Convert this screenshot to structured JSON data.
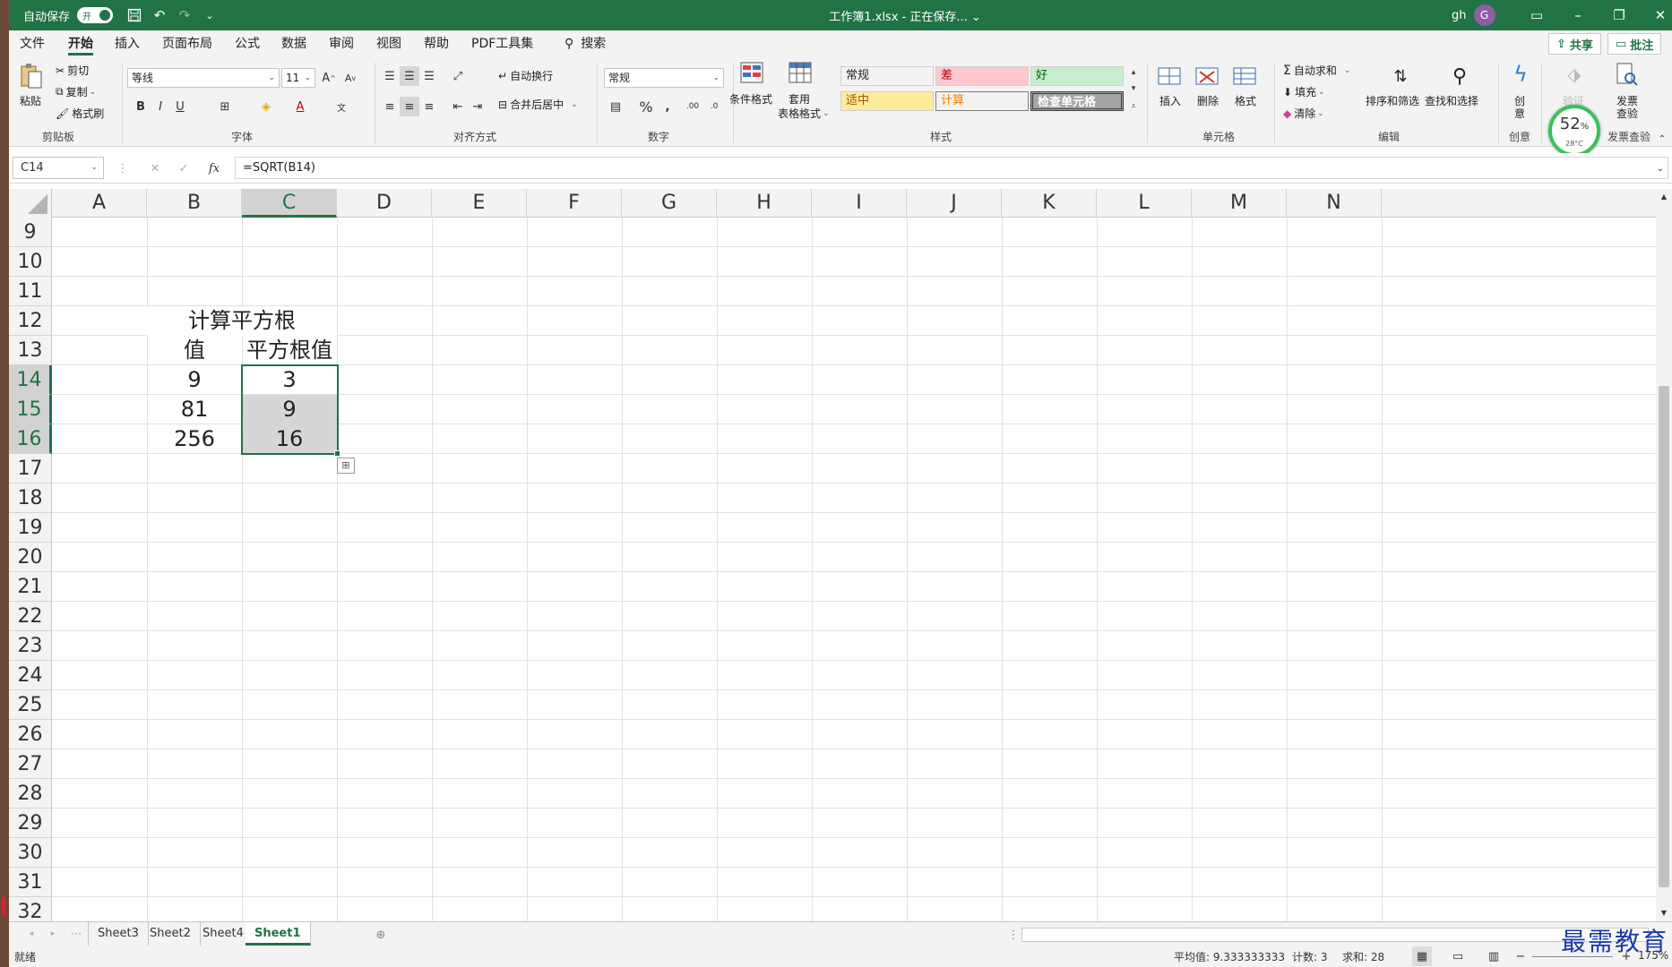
{
  "titlebar": {
    "autosave_label": "自动保存",
    "autosave_state": "开",
    "doc_title": "工作簿1.xlsx - 正在保存... ⌄",
    "user_name": "gh",
    "avatar_letter": "G"
  },
  "tabs": [
    "文件",
    "开始",
    "插入",
    "页面布局",
    "公式",
    "数据",
    "审阅",
    "视图",
    "帮助",
    "PDF工具集"
  ],
  "active_tab": "开始",
  "search_label": "搜索",
  "share_label": "共享",
  "comment_label": "批注",
  "ribbon": {
    "clipboard": {
      "paste": "粘贴",
      "cut": "剪切",
      "copy": "复制",
      "format_painter": "格式刷",
      "label": "剪贴板"
    },
    "font": {
      "name": "等线",
      "size": "11",
      "label": "字体"
    },
    "alignment": {
      "wrap": "自动换行",
      "merge": "合并后居中",
      "label": "对齐方式"
    },
    "number": {
      "format": "常规",
      "label": "数字"
    },
    "styles": {
      "conditional": "条件格式",
      "table_line1": "套用",
      "table_line2": "表格格式",
      "cells": [
        {
          "text": "常规",
          "bg": "#ffffff",
          "color": "#222222"
        },
        {
          "text": "差",
          "bg": "#ffc7ce",
          "color": "#9c0006"
        },
        {
          "text": "好",
          "bg": "#c6efce",
          "color": "#006100"
        },
        {
          "text": "适中",
          "bg": "#ffeb9c",
          "color": "#9c5700"
        },
        {
          "text": "计算",
          "bg": "#f2f2f2",
          "color": "#fa7d00"
        },
        {
          "text": "检查单元格",
          "bg": "#a5a5a5",
          "color": "#ffffff"
        }
      ],
      "label": "样式"
    },
    "cells_group": {
      "insert": "插入",
      "delete": "删除",
      "format": "格式",
      "label": "单元格"
    },
    "editing": {
      "autosum": "自动求和",
      "fill": "填充",
      "clear": "清除",
      "sort": "排序和筛选",
      "find": "查找和选择",
      "label": "编辑"
    },
    "creative": {
      "btn_line1": "创",
      "btn_line2": "意",
      "label": "创意"
    },
    "invoice": {
      "line1": "发票",
      "line2": "查验",
      "label": "发票查验"
    },
    "faded_btn": "验证"
  },
  "badge": {
    "percent": "52",
    "percent_sign": "%",
    "temp": "28°C"
  },
  "formula_bar": {
    "name_box": "C14",
    "formula": "=SQRT(B14)"
  },
  "columns": [
    "A",
    "B",
    "C",
    "D",
    "E",
    "F",
    "G",
    "H",
    "I",
    "J",
    "K",
    "L",
    "M",
    "N"
  ],
  "selected_column": "C",
  "rows": [
    "9",
    "10",
    "11",
    "12",
    "13",
    "14",
    "15",
    "16",
    "17",
    "18",
    "19",
    "20",
    "21",
    "22",
    "23",
    "24",
    "25",
    "26",
    "27",
    "28",
    "29",
    "30",
    "31",
    "32"
  ],
  "selected_rows": [
    "14",
    "15",
    "16"
  ],
  "sheet": {
    "title": "计算平方根",
    "header_value": "值",
    "header_sqrt": "平方根值",
    "data": [
      {
        "value": "9",
        "sqrt": "3"
      },
      {
        "value": "81",
        "sqrt": "9"
      },
      {
        "value": "256",
        "sqrt": "16"
      }
    ]
  },
  "sheet_tabs": [
    "Sheet3",
    "Sheet2",
    "Sheet4",
    "Sheet1"
  ],
  "active_sheet": "Sheet1",
  "status": {
    "ready": "就绪",
    "average": "平均值: 9.333333333",
    "count": "计数: 3",
    "sum": "求和: 28",
    "zoom": "175%"
  },
  "watermark": "最需教育"
}
